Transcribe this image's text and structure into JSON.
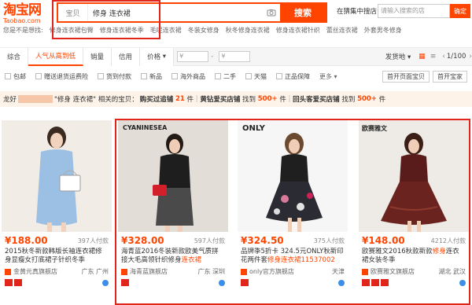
{
  "logo": {
    "cn": "淘宝网",
    "en": "Taobao.com"
  },
  "search": {
    "type": "宝贝",
    "query": "修身 连衣裙",
    "button": "搜索"
  },
  "shop_search": {
    "label": "在猜集中搜店",
    "placeholder": "请输入搜索的店",
    "button": "确定"
  },
  "hot": [
    "您是不是想找:",
    "修身连衣裙包臀",
    "修身连衣裙冬季",
    "毛呢连衣裙",
    "冬装女修身",
    "秋冬修身连衣裙",
    "修身连衣裙针织",
    "蕾丝连衣裙",
    "外套男冬修身"
  ],
  "sort": {
    "tabs": [
      "综合",
      "人气从高到低",
      "销量",
      "信用",
      "价格"
    ],
    "price_from": "¥",
    "price_to": "¥",
    "right": [
      "发货地",
      "1/100"
    ]
  },
  "filters": {
    "items": [
      "包邮",
      "赠送退货运费险",
      "货到付款",
      "新品",
      "海外商品",
      "二手",
      "天猫",
      "正品保障"
    ],
    "more": "更多",
    "btn1": "首开页面宝贝",
    "btn2": "首开宝家"
  },
  "related": {
    "prefix": "龙好",
    "mid": "\"修身 连衣裙\" 相关的宝贝：",
    "t1": "购买过追铺",
    "c1": "21",
    "u1": "件",
    "sep": "|",
    "t2": "黄钻爱买店铺",
    "f2": "找到",
    "c2": "500+",
    "u2": "件",
    "t3": "回头客爱买店铺",
    "f3": "找到",
    "c3": "500+",
    "u3": "件"
  },
  "products": [
    {
      "brand": "",
      "price": "¥188.00",
      "paid": "397人付款",
      "title_a": "2015秋冬新款韩版长袖连衣裙修身显",
      "title_b": "瘦女打底裙子针织冬季",
      "shop": "金黄元真旗舰店",
      "loc": "广东 广州"
    },
    {
      "brand": "CYANINESEA",
      "price": "¥328.00",
      "paid": "597人付款",
      "title_a": "海青蓝2016冬装新款欧美气质拼接大",
      "title_b": "毛高领针织修身",
      "title_hl": "连衣裙",
      "shop": "海青蓝旗舰店",
      "loc": "广东 深圳"
    },
    {
      "brand": "ONLY",
      "price": "¥324.50",
      "paid": "375人付款",
      "title_a": "品牌季5折卡 324.5元ONLY秋新",
      "title_b": "印花两件套",
      "title_hl": "修身连衣裙11537002",
      "shop": "only官方旗舰店",
      "loc": "天津"
    },
    {
      "brand": "欧赛雅文",
      "price": "¥148.00",
      "paid": "4212人付款",
      "title_a": "欧赛雅文2016秋款新款",
      "title_b": "连衣裙女装冬季",
      "title_hl": "修身",
      "shop": "欧赛雅文旗舰店",
      "loc": "湖北 武汉"
    }
  ],
  "colors": {
    "accent": "#ff4400",
    "highlight": "#e1251b"
  }
}
